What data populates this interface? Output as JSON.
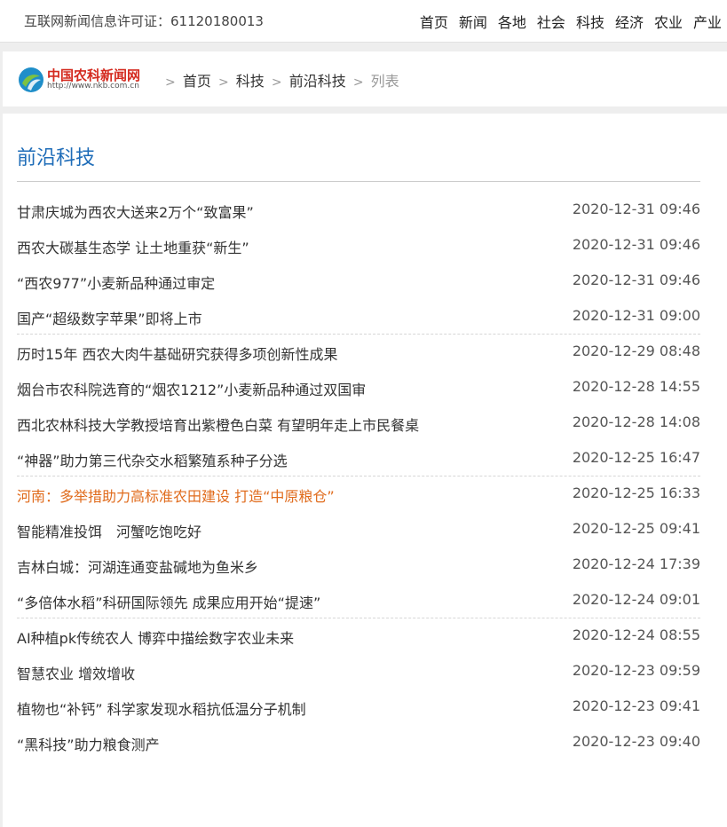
{
  "topbar": {
    "license": "互联网新闻信息许可证：61120180013",
    "nav": [
      "首页",
      "新闻",
      "各地",
      "社会",
      "科技",
      "经济",
      "农业",
      "产业"
    ]
  },
  "logo": {
    "name": "中国农科新闻网",
    "url": "http://www.nkb.com.cn"
  },
  "breadcrumb": {
    "sep": ">",
    "links": [
      "首页",
      "科技",
      "前沿科技"
    ],
    "current": "列表"
  },
  "section": {
    "title": "前沿科技"
  },
  "colors": {
    "accent": "#1e6cb8",
    "highlight": "#e06b1c",
    "logo_red": "#d42a1f"
  },
  "articles": [
    {
      "title": "甘肃庆城为西农大送来2万个“致富果”",
      "date": "2020-12-31 09:46"
    },
    {
      "title": "西农大碳基生态学 让土地重获“新生”",
      "date": "2020-12-31 09:46"
    },
    {
      "title": "“西农977”小麦新品种通过审定",
      "date": "2020-12-31 09:46"
    },
    {
      "title": "国产“超级数字苹果”即将上市",
      "date": "2020-12-31 09:00"
    },
    {
      "title": "历时15年 西农大肉牛基础研究获得多项创新性成果",
      "date": "2020-12-29 08:48"
    },
    {
      "title": "烟台市农科院选育的“烟农1212”小麦新品种通过双国审",
      "date": "2020-12-28 14:55"
    },
    {
      "title": "西北农林科技大学教授培育出紫橙色白菜 有望明年走上市民餐桌",
      "date": "2020-12-28 14:08"
    },
    {
      "title": "“神器”助力第三代杂交水稻繁殖系种子分选",
      "date": "2020-12-25 16:47"
    },
    {
      "title": "河南：多举措助力高标准农田建设 打造“中原粮仓”",
      "date": "2020-12-25 16:33",
      "highlighted": true
    },
    {
      "title": "智能精准投饵　河蟹吃饱吃好",
      "date": "2020-12-25 09:41"
    },
    {
      "title": "吉林白城：河湖连通变盐碱地为鱼米乡",
      "date": "2020-12-24 17:39"
    },
    {
      "title": "“多倍体水稻”科研国际领先 成果应用开始“提速”",
      "date": "2020-12-24 09:01"
    },
    {
      "title": "AI种植pk传统农人 博弈中描绘数字农业未来",
      "date": "2020-12-24 08:55"
    },
    {
      "title": "智慧农业 增效增收",
      "date": "2020-12-23 09:59"
    },
    {
      "title": "植物也“补钙” 科学家发现水稻抗低温分子机制",
      "date": "2020-12-23 09:41"
    },
    {
      "title": "“黑科技”助力粮食测产",
      "date": "2020-12-23 09:40"
    }
  ]
}
